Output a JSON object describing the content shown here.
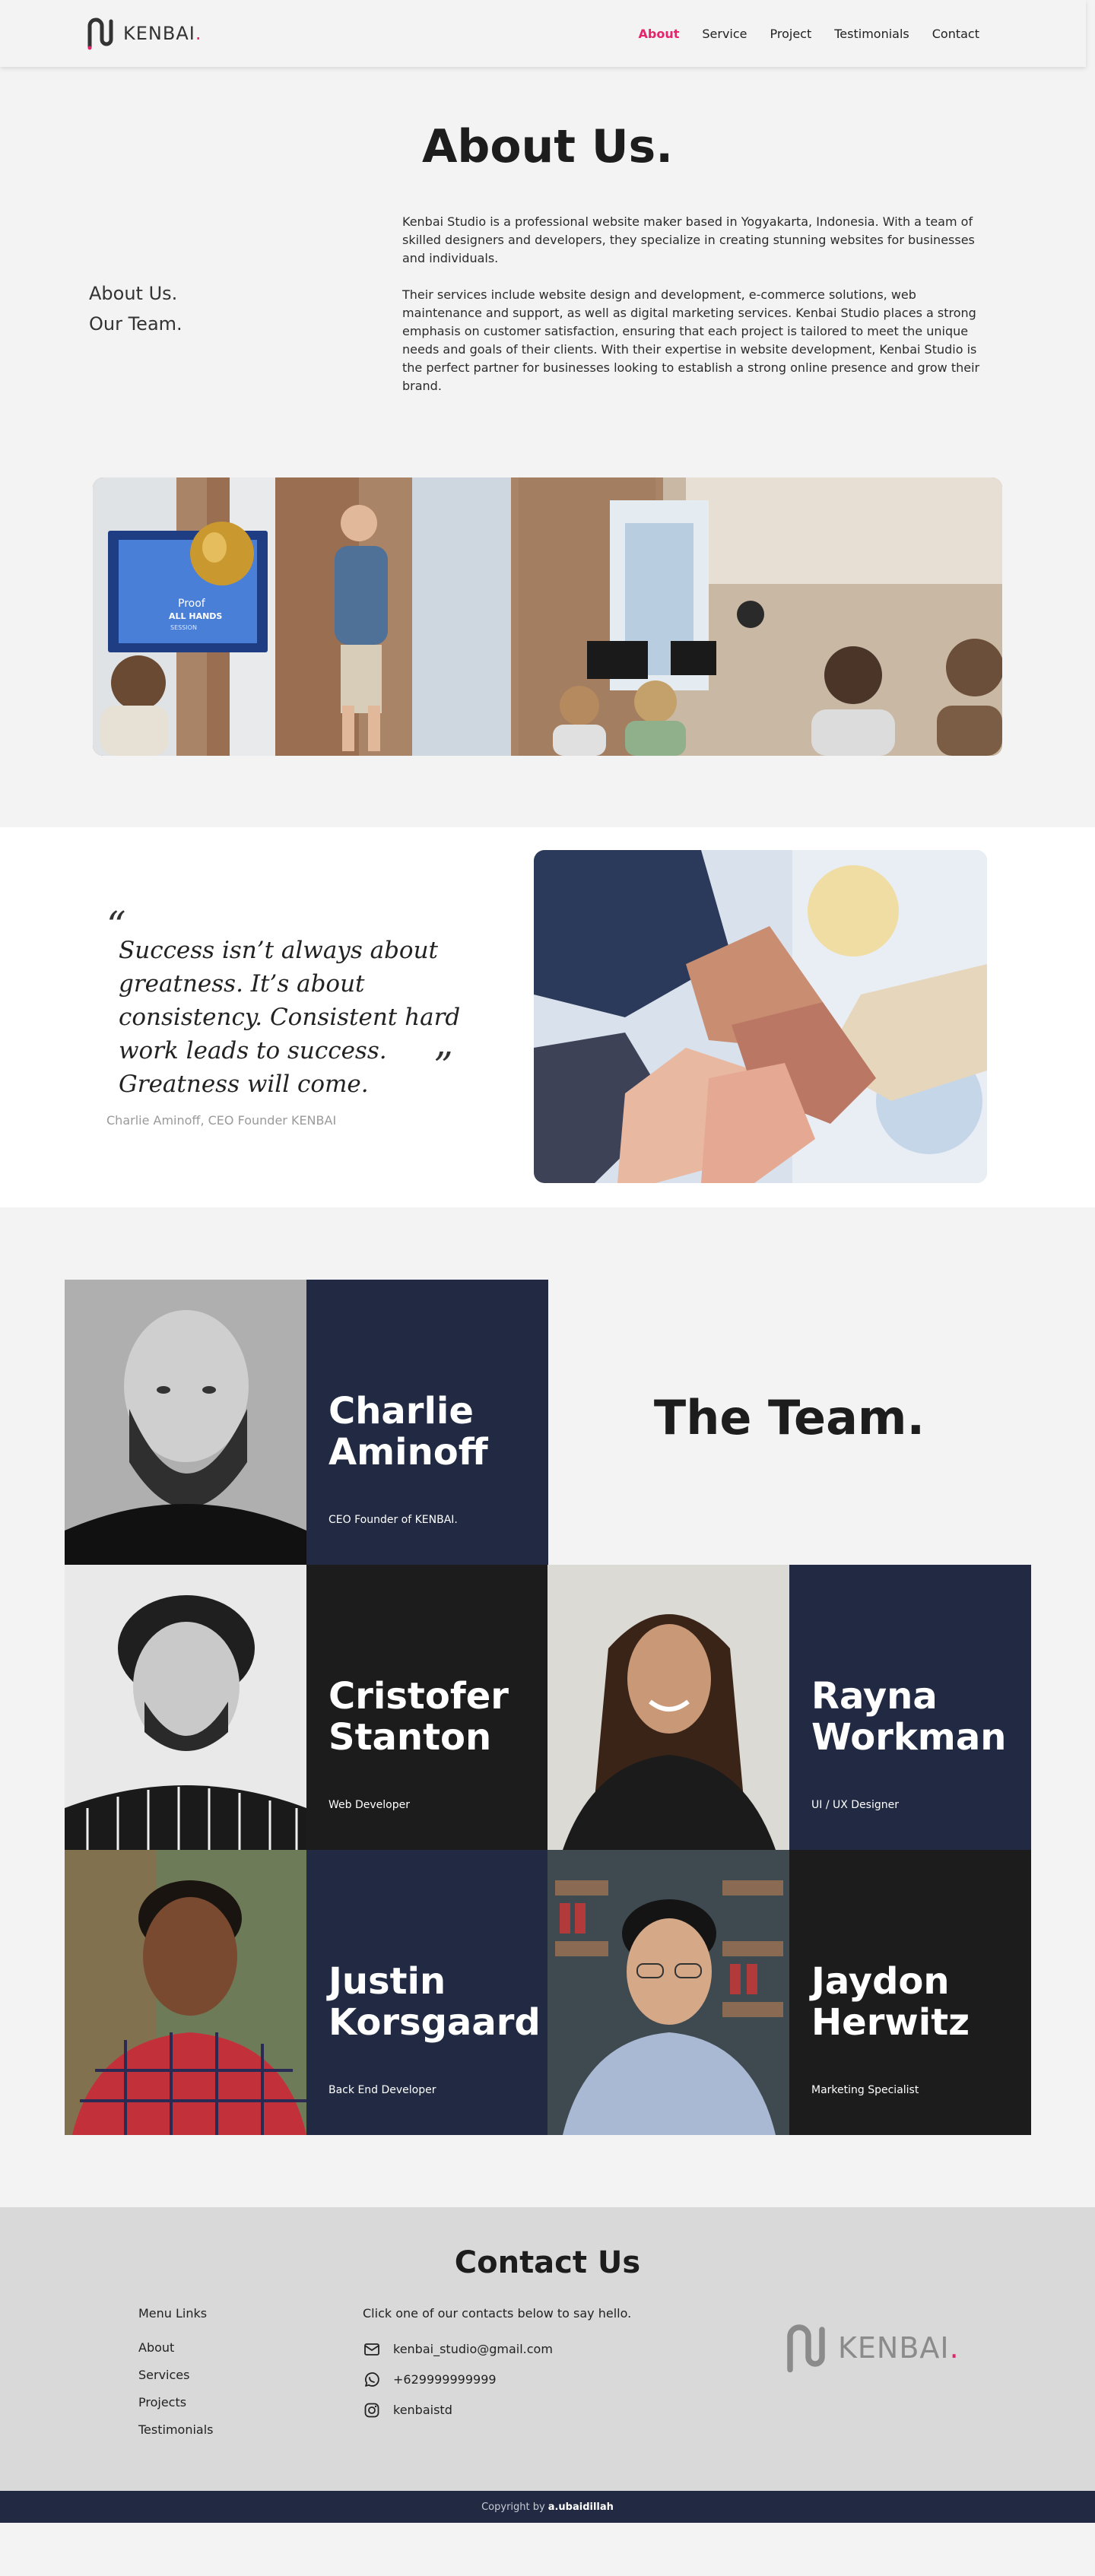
{
  "brand": {
    "name": "KENBAI",
    "dot": ".",
    "accent_color": "#e5246b",
    "navy_color": "#212a42"
  },
  "nav": {
    "items": [
      {
        "label": "About",
        "active": true
      },
      {
        "label": "Service",
        "active": false
      },
      {
        "label": "Project",
        "active": false
      },
      {
        "label": "Testimonials",
        "active": false
      },
      {
        "label": "Contact",
        "active": false
      }
    ]
  },
  "about": {
    "title": "About Us.",
    "side_line1": "About Us.",
    "side_line2": "Our Team.",
    "para1": "Kenbai Studio is a professional website maker based in Yogyakarta, Indonesia. With a team of skilled designers and developers, they specialize in creating stunning websites for businesses and individuals.",
    "para2": "Their services include website design and development, e-commerce solutions, web maintenance and support, as well as digital marketing services. Kenbai Studio places a strong emphasis on customer satisfaction, ensuring that each project is tailored to meet the unique needs and goals of their clients. With their expertise in website development, Kenbai Studio is the perfect partner for businesses looking to establish a strong online presence and grow their brand.",
    "screen_text1": "Proof",
    "screen_text2": "ALL HANDS",
    "screen_text3": "SESSION"
  },
  "quote": {
    "open": "“",
    "text": "Success isn’t always about greatness. It’s about consistency. Consistent hard work leads to success. Greatness will come.",
    "close": "”",
    "author": "Charlie Aminoff, CEO Founder KENBAI"
  },
  "team": {
    "title": "The Team.",
    "members": [
      {
        "name": "Charlie Aminoff",
        "role": "CEO Founder of KENBAI.",
        "panel": "navy"
      },
      {
        "name": "Cristofer Stanton",
        "role": "Web Developer",
        "panel": "black"
      },
      {
        "name": "Rayna Workman",
        "role": "UI / UX Designer",
        "panel": "navy"
      },
      {
        "name": "Justin Korsgaard",
        "role": "Back End Developer",
        "panel": "navy"
      },
      {
        "name": "Jaydon Herwitz",
        "role": "Marketing Specialist",
        "panel": "black"
      }
    ]
  },
  "contact": {
    "title": "Contact Us",
    "menu_heading": "Menu Links",
    "menu_links": [
      "About",
      "Services",
      "Projects",
      "Testimonials"
    ],
    "contacts_heading": "Click one of our contacts below to say hello.",
    "email": "kenbai_studio@gmail.com",
    "phone": "+629999999999",
    "instagram": "kenbaistd",
    "icons": [
      "mail-icon",
      "whatsapp-icon",
      "instagram-icon"
    ]
  },
  "footer": {
    "copyright_prefix": "Copyright by",
    "author": "a.ubaidillah"
  }
}
